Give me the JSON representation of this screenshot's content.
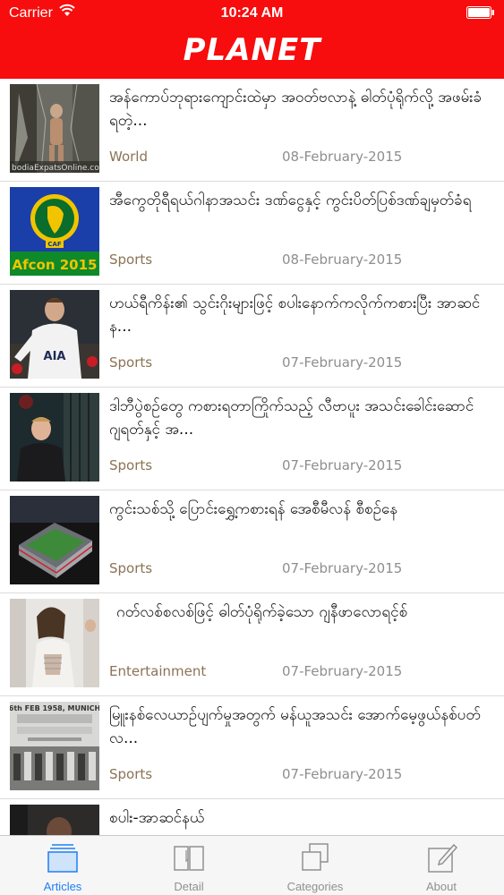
{
  "status_bar": {
    "carrier": "Carrier",
    "time": "10:24 AM"
  },
  "header": {
    "title": "PLANET",
    "color": "#f70d0d"
  },
  "articles": [
    {
      "title": "အန်ကောပ်ဘုရားကျောင်းထဲမှာ အဝတ်ဗလာနဲ့ ဓါတ်ပုံရိုက်လို့ အဖမ်းခံရတဲ့...",
      "category": "World",
      "date": "08-February-2015",
      "thumb_text": "bodiaExpatsOnline.co"
    },
    {
      "title": "အီကွေတိုရီရယ်ဂါနာအသင်း ဒဏ်ငွေနှင့် ကွင်းပိတ်ပြစ်ဒဏ်ချမှတ်ခံရ",
      "category": "Sports",
      "date": "08-February-2015",
      "thumb_text": "Afcon 2015"
    },
    {
      "title": "ဟယ်ရီကိန်း၏ သွင်းဂိုးများဖြင့် စပါးနောက်ကလိုက်ကစားပြီး အာဆင်န...",
      "category": "Sports",
      "date": "07-February-2015",
      "thumb_text": "AIA"
    },
    {
      "title": "ဒါဘီပွဲစဉ်တွေ ကစားရတာကြိုက်သည့် လီဗာပူး အသင်းခေါင်းဆောင် ဂျရတ်နှင့် အ...",
      "category": "Sports",
      "date": "07-February-2015",
      "thumb_text": ""
    },
    {
      "title": "ကွင်းသစ်သို့ ပြောင်းရွှေ့ကစားရန် အေစီမီလန် စီစဉ်နေ",
      "category": "Sports",
      "date": "07-February-2015",
      "thumb_text": ""
    },
    {
      "title": "ဂတ်လစ်စလစ်ဖြင့် ဓါတ်ပုံရိုက်ခဲ့သော ဂျနီဖာလောရင့်စ်",
      "category": "Entertainment",
      "date": "07-February-2015",
      "thumb_text": ""
    },
    {
      "title": "မြူးနစ်လေယာဉ်ပျက်မှုအတွက် မန်ယူအသင်း အောက်မေ့ဖွယ်နစ်ပတ်လ...",
      "category": "Sports",
      "date": "07-February-2015",
      "thumb_text": "6th FEB 1958, MUNICH"
    },
    {
      "title": "စပါး-အာဆင်နယ်",
      "category": "",
      "date": "",
      "thumb_text": ""
    }
  ],
  "tabbar": {
    "accent": "#1e7ef5",
    "tabs": [
      {
        "label": "Articles",
        "icon": "articles-stack-icon",
        "active": true
      },
      {
        "label": "Detail",
        "icon": "book-icon",
        "active": false
      },
      {
        "label": "Categories",
        "icon": "categories-icon",
        "active": false
      },
      {
        "label": "About",
        "icon": "edit-icon",
        "active": false
      }
    ]
  }
}
